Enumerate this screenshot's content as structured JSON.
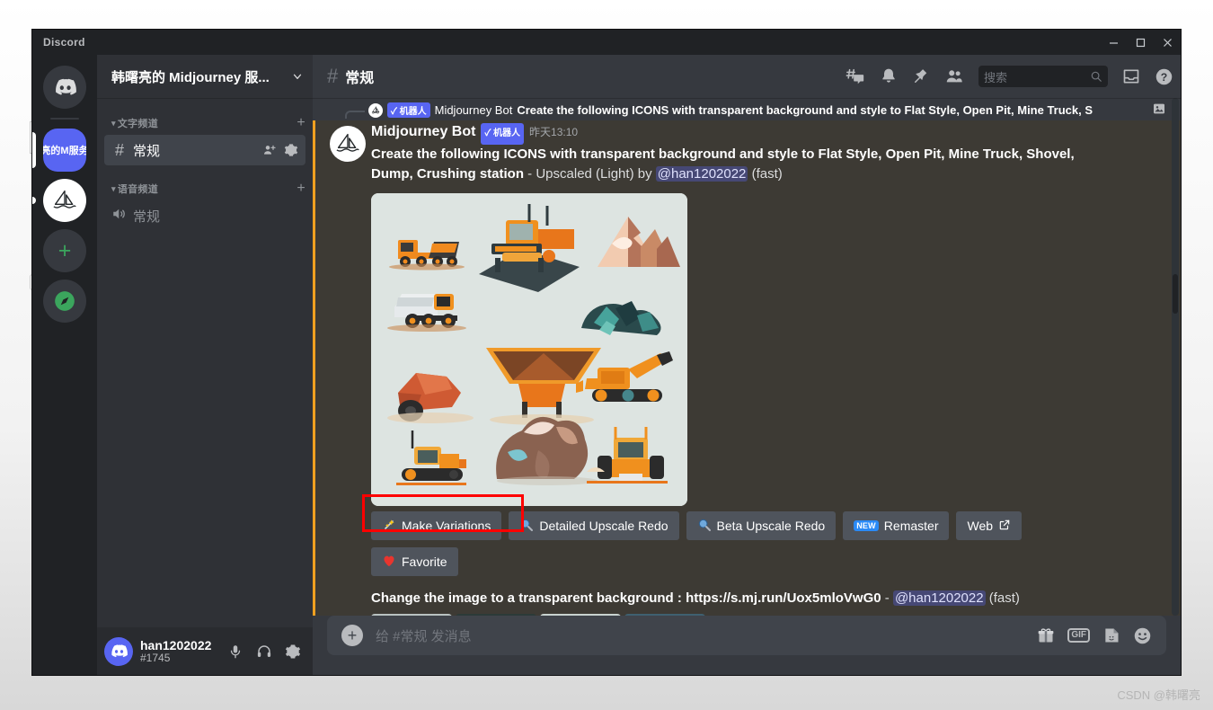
{
  "window": {
    "app_title": "Discord",
    "controls": {
      "minimize": "minimize-button",
      "maximize": "maximize-button",
      "close": "close-button"
    }
  },
  "server_rail": {
    "items": [
      {
        "name": "home",
        "label": "",
        "type": "discord-home"
      },
      {
        "name": "active-server",
        "label": "亮的M服务",
        "type": "server-active"
      },
      {
        "name": "midjourney-server",
        "label": "",
        "type": "server-midjourney"
      },
      {
        "name": "add-server",
        "label": "+",
        "type": "add"
      },
      {
        "name": "explore",
        "label": "",
        "type": "compass"
      }
    ]
  },
  "sidebar": {
    "server_name": "韩曙亮的 Midjourney 服...",
    "categories": [
      {
        "label": "文字频道",
        "add_label": "+",
        "channels": [
          {
            "label": "常规",
            "type": "text",
            "selected": true
          }
        ]
      },
      {
        "label": "语音频道",
        "add_label": "+",
        "channels": [
          {
            "label": "常规",
            "type": "voice",
            "selected": false
          }
        ]
      }
    ]
  },
  "user_panel": {
    "username": "han1202022",
    "tag": "#1745",
    "icons": [
      "microphone-icon",
      "headphones-icon",
      "settings-gear-icon"
    ]
  },
  "channel_header": {
    "hash": "#",
    "title": "常规",
    "icons": [
      "threads-icon",
      "notification-bell-icon",
      "pin-icon",
      "members-icon",
      "inbox-icon",
      "help-icon"
    ]
  },
  "search": {
    "placeholder": "搜索"
  },
  "reply_bar": {
    "bot_tag": "✓ 机器人",
    "author": "Midjourney Bot",
    "text": "Create the following ICONS with transparent background and style to Flat Style, Open Pit, Mine Truck, S"
  },
  "message": {
    "author": "Midjourney Bot",
    "bot_tag": "✓ 机器人",
    "timestamp": "昨天13:10",
    "prompt_bold": "Create the following ICONS with transparent background and style to Flat Style, Open Pit, Mine Truck, Shovel, Dump, Crushing station",
    "separator": " - ",
    "status": "Upscaled (Light) by ",
    "mention": "@han1202022",
    "speed": " (fast)",
    "image_alt": "3x3 grid of flat style mining icons"
  },
  "action_buttons": [
    {
      "label": "Make Variations",
      "icon": "sparkles-icon",
      "highlighted": true
    },
    {
      "label": "Detailed Upscale Redo",
      "icon": "magnifier-icon",
      "highlighted": false
    },
    {
      "label": "Beta Upscale Redo",
      "icon": "magnifier-icon",
      "highlighted": false
    },
    {
      "label": "Remaster",
      "icon": "new-badge",
      "badge": "NEW",
      "highlighted": false
    },
    {
      "label": "Web",
      "icon": "external-link-icon",
      "highlighted": false
    }
  ],
  "favorite_button": {
    "label": "Favorite",
    "icon": "heart-icon"
  },
  "next_message": {
    "bold_text": "Change the image to a transparent background : ",
    "link": "https://s.mj.run/Uox5mloVwG0",
    "separator": " - ",
    "mention": "@han1202022",
    "speed": " (fast)"
  },
  "composer": {
    "placeholder": "给 #常规 发消息",
    "add_label": "+",
    "icons": [
      "gift-icon",
      "gif-icon",
      "sticker-icon",
      "emoji-icon"
    ],
    "gif_label": "GIF"
  },
  "watermark": "CSDN @韩曙亮"
}
